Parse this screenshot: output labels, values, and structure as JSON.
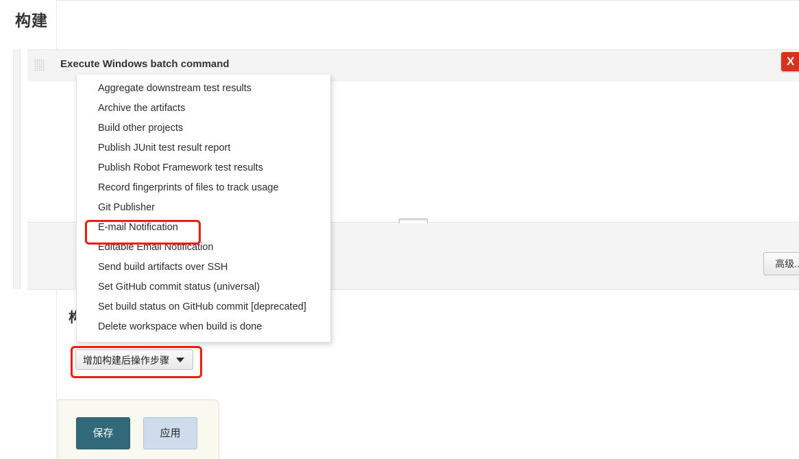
{
  "page": {
    "section_title": "构建",
    "occluded_heading": "构"
  },
  "build_step": {
    "drag_handle_icon": "drag-grip-icon",
    "title": "Execute Windows batch command",
    "delete_icon": "close-x-icon",
    "delete_label": "X",
    "command_value": "",
    "resize_handle_icon": "textarea-resize-grip-icon",
    "advanced_label": "高级..."
  },
  "post_build": {
    "add_step_label": "增加构建后操作步骤",
    "caret_icon": "chevron-down-icon",
    "menu_items": [
      "Aggregate downstream test results",
      "Archive the artifacts",
      "Build other projects",
      "Publish JUnit test result report",
      "Publish Robot Framework test results",
      "Record fingerprints of files to track usage",
      "Git Publisher",
      "E-mail Notification",
      "Editable Email Notification",
      "Send build artifacts over SSH",
      "Set GitHub commit status (universal)",
      "Set build status on GitHub commit [deprecated]",
      "Delete workspace when build is done"
    ],
    "highlighted_item": "E-mail Notification"
  },
  "footer": {
    "save_label": "保存",
    "apply_label": "应用"
  },
  "colors": {
    "annotation_red": "#f51a0f",
    "delete_red": "#d9301f",
    "save_teal": "#31687a",
    "apply_blue": "#cfdceb"
  }
}
